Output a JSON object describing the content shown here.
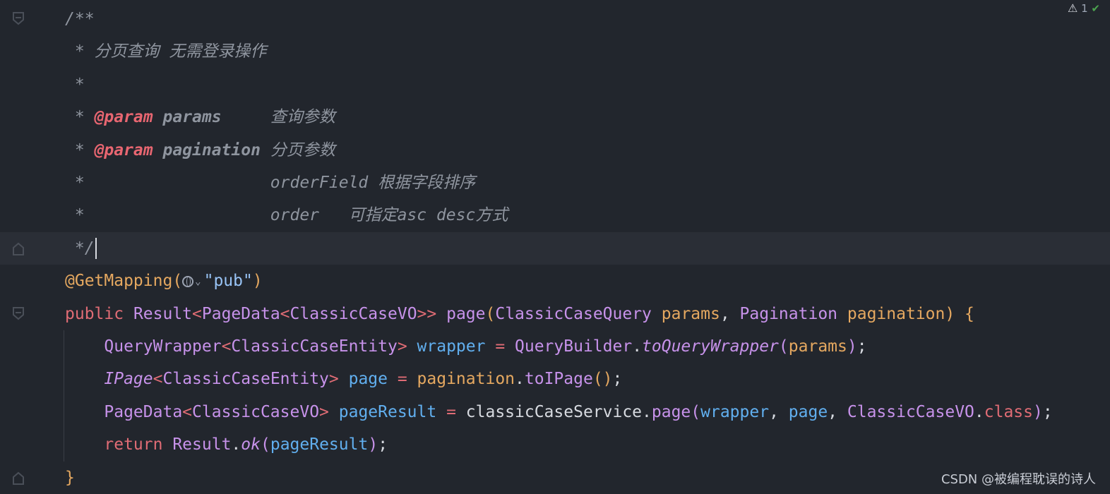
{
  "status_bar": {
    "warning_icon": "warning-icon",
    "warning_count": "1",
    "check_icon": "check-icon"
  },
  "watermark": "CSDN @被编程耽误的诗人",
  "colors": {
    "background": "#22262d",
    "current_line": "#2a2e36",
    "comment": "#8f959f",
    "doc_tag": "#e86671",
    "keyword": "#e06c75",
    "type": "#c792ea",
    "param": "#e5a860",
    "variable": "#61afef",
    "string": "#98c3f5",
    "plain": "#d7dae0"
  },
  "lines": [
    {
      "fold": "fold-open",
      "tokens": [
        {
          "t": "/**",
          "c": "comment"
        }
      ]
    },
    {
      "tokens": [
        {
          "t": " * ",
          "c": "comment"
        },
        {
          "t": "分页查询 无需登录操作",
          "c": "comment"
        }
      ]
    },
    {
      "tokens": [
        {
          "t": " *",
          "c": "comment"
        }
      ]
    },
    {
      "tokens": [
        {
          "t": " * ",
          "c": "comment"
        },
        {
          "t": "@param",
          "c": "doc_tag"
        },
        {
          "t": " ",
          "c": "comment"
        },
        {
          "t": "params",
          "c": "doc_param"
        },
        {
          "t": "     查询参数",
          "c": "comment"
        }
      ]
    },
    {
      "tokens": [
        {
          "t": " * ",
          "c": "comment"
        },
        {
          "t": "@param",
          "c": "doc_tag"
        },
        {
          "t": " ",
          "c": "comment"
        },
        {
          "t": "pagination",
          "c": "doc_param"
        },
        {
          "t": " 分页参数",
          "c": "comment"
        }
      ]
    },
    {
      "tokens": [
        {
          "t": " *                   orderField 根据字段排序",
          "c": "comment"
        }
      ]
    },
    {
      "tokens": [
        {
          "t": " *                   order   可指定asc desc方式",
          "c": "comment"
        }
      ]
    },
    {
      "fold": "fold-close",
      "current": true,
      "caret": true,
      "tokens": [
        {
          "t": " */",
          "c": "comment"
        }
      ]
    },
    {
      "tokens": [
        {
          "t": "@GetMapping(",
          "c": "param"
        },
        {
          "t": "GLOBE",
          "c": "globe"
        },
        {
          "t": "\"pub\"",
          "c": "string"
        },
        {
          "t": ")",
          "c": "param"
        }
      ]
    },
    {
      "fold": "fold-open",
      "tokens": [
        {
          "t": "public ",
          "c": "keyword"
        },
        {
          "t": "Result",
          "c": "type"
        },
        {
          "t": "<",
          "c": "keyword"
        },
        {
          "t": "PageData",
          "c": "type"
        },
        {
          "t": "<",
          "c": "keyword"
        },
        {
          "t": "ClassicCaseVO",
          "c": "type"
        },
        {
          "t": ">> ",
          "c": "keyword"
        },
        {
          "t": "page",
          "c": "type"
        },
        {
          "t": "(",
          "c": "param"
        },
        {
          "t": "ClassicCaseQuery ",
          "c": "type"
        },
        {
          "t": "params",
          "c": "param"
        },
        {
          "t": ", ",
          "c": "plain"
        },
        {
          "t": "Pagination ",
          "c": "type"
        },
        {
          "t": "pagination",
          "c": "param"
        },
        {
          "t": ") {",
          "c": "param"
        }
      ]
    },
    {
      "tokens": [
        {
          "t": "    ",
          "c": "plain"
        },
        {
          "t": "QueryWrapper",
          "c": "type"
        },
        {
          "t": "<",
          "c": "keyword"
        },
        {
          "t": "ClassicCaseEntity",
          "c": "type"
        },
        {
          "t": "> ",
          "c": "keyword"
        },
        {
          "t": "wrapper",
          "c": "variable"
        },
        {
          "t": " = ",
          "c": "keyword"
        },
        {
          "t": "QueryBuilder",
          "c": "type"
        },
        {
          "t": ".",
          "c": "plain"
        },
        {
          "t": "toQueryWrapper",
          "c": "type_italic"
        },
        {
          "t": "(",
          "c": "type"
        },
        {
          "t": "params",
          "c": "param"
        },
        {
          "t": ")",
          "c": "type"
        },
        {
          "t": ";",
          "c": "plain"
        }
      ]
    },
    {
      "tokens": [
        {
          "t": "    ",
          "c": "plain"
        },
        {
          "t": "IPage",
          "c": "type_italic"
        },
        {
          "t": "<",
          "c": "keyword"
        },
        {
          "t": "ClassicCaseEntity",
          "c": "type"
        },
        {
          "t": "> ",
          "c": "keyword"
        },
        {
          "t": "page",
          "c": "variable"
        },
        {
          "t": " = ",
          "c": "keyword"
        },
        {
          "t": "pagination",
          "c": "param"
        },
        {
          "t": ".",
          "c": "plain"
        },
        {
          "t": "toIPage",
          "c": "type"
        },
        {
          "t": "()",
          "c": "param"
        },
        {
          "t": ";",
          "c": "plain"
        }
      ]
    },
    {
      "tokens": [
        {
          "t": "    ",
          "c": "plain"
        },
        {
          "t": "PageData",
          "c": "type"
        },
        {
          "t": "<",
          "c": "keyword"
        },
        {
          "t": "ClassicCaseVO",
          "c": "type"
        },
        {
          "t": "> ",
          "c": "keyword"
        },
        {
          "t": "pageResult",
          "c": "variable"
        },
        {
          "t": " = ",
          "c": "keyword"
        },
        {
          "t": "classicCaseService",
          "c": "plain"
        },
        {
          "t": ".",
          "c": "plain"
        },
        {
          "t": "page",
          "c": "type"
        },
        {
          "t": "(",
          "c": "type"
        },
        {
          "t": "wrapper",
          "c": "variable"
        },
        {
          "t": ", ",
          "c": "plain"
        },
        {
          "t": "page",
          "c": "variable"
        },
        {
          "t": ", ",
          "c": "plain"
        },
        {
          "t": "ClassicCaseVO",
          "c": "type"
        },
        {
          "t": ".",
          "c": "plain"
        },
        {
          "t": "class",
          "c": "keyword"
        },
        {
          "t": ")",
          "c": "type"
        },
        {
          "t": ";",
          "c": "plain"
        }
      ]
    },
    {
      "tokens": [
        {
          "t": "    ",
          "c": "plain"
        },
        {
          "t": "return ",
          "c": "keyword"
        },
        {
          "t": "Result",
          "c": "type"
        },
        {
          "t": ".",
          "c": "plain"
        },
        {
          "t": "ok",
          "c": "type_italic"
        },
        {
          "t": "(",
          "c": "type"
        },
        {
          "t": "pageResult",
          "c": "variable"
        },
        {
          "t": ")",
          "c": "type"
        },
        {
          "t": ";",
          "c": "plain"
        }
      ]
    },
    {
      "fold": "fold-close",
      "tokens": [
        {
          "t": "}",
          "c": "param"
        }
      ]
    }
  ]
}
